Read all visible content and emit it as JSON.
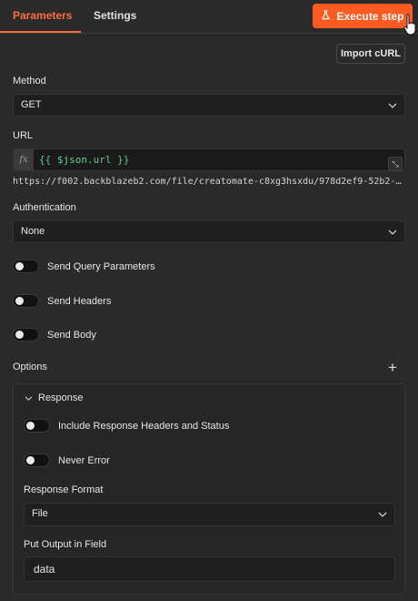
{
  "tabs": [
    {
      "label": "Parameters",
      "active": true
    },
    {
      "label": "Settings",
      "active": false
    }
  ],
  "execute_button": {
    "label": "Execute step",
    "icon": "flask-icon",
    "color": "#ff5a1f"
  },
  "import_button": {
    "label": "Import cURL"
  },
  "method": {
    "label": "Method",
    "value": "GET"
  },
  "url": {
    "label": "URL",
    "fx_label": "fx",
    "expression": "{{ $json.url }}",
    "preview": "https://f002.backblazeb2.com/file/creatomate-c8xg3hsxdu/978d2ef9-52b2-4..."
  },
  "authentication": {
    "label": "Authentication",
    "value": "None"
  },
  "toggles": [
    {
      "label": "Send Query Parameters",
      "on": false
    },
    {
      "label": "Send Headers",
      "on": false
    },
    {
      "label": "Send Body",
      "on": false
    }
  ],
  "options": {
    "label": "Options",
    "add_icon": "plus-icon",
    "response": {
      "label": "Response",
      "toggles": [
        {
          "label": "Include Response Headers and Status",
          "on": false
        },
        {
          "label": "Never Error",
          "on": false
        }
      ],
      "format": {
        "label": "Response Format",
        "value": "File"
      },
      "output_field": {
        "label": "Put Output in Field",
        "value": "data"
      }
    }
  },
  "colors": {
    "accent": "#ff6d3d",
    "expression": "#5ad08a",
    "background": "#2a2a2a"
  }
}
